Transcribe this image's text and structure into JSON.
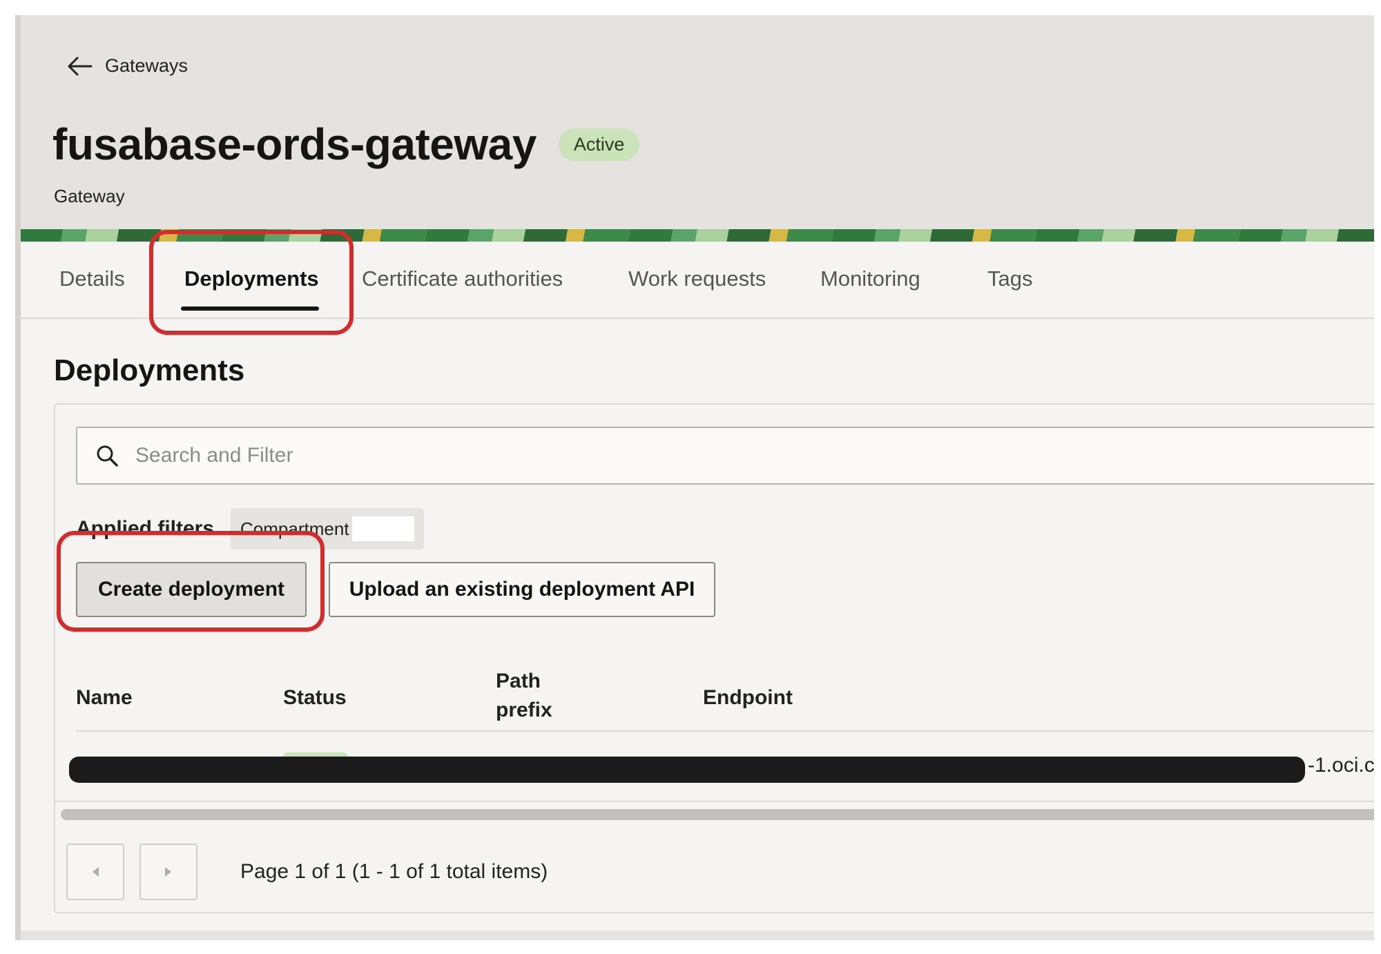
{
  "header": {
    "back_label": "Gateways",
    "title": "fusabase-ords-gateway",
    "status_badge": "Active",
    "subtitle": "Gateway"
  },
  "tabs": [
    {
      "label": "Details"
    },
    {
      "label": "Deployments",
      "active": true
    },
    {
      "label": "Certificate authorities"
    },
    {
      "label": "Work requests"
    },
    {
      "label": "Monitoring"
    },
    {
      "label": "Tags"
    }
  ],
  "section": {
    "title": "Deployments"
  },
  "search": {
    "placeholder": "Search and Filter"
  },
  "filters": {
    "label": "Applied filters",
    "chips": [
      {
        "name": "Compartment"
      }
    ]
  },
  "actions": {
    "create_label": "Create deployment",
    "upload_label": "Upload an existing deployment API"
  },
  "table": {
    "columns": [
      "Name",
      "Status",
      "Path\nprefix",
      "Endpoint"
    ],
    "rows": [
      {
        "endpoint_visible": "-1.oci.c"
      }
    ]
  },
  "pagination": {
    "text": "Page 1 of 1 (1 - 1 of 1 total items)"
  },
  "colors": {
    "annotation": "#d62b2b",
    "badge_bg": "#cbe3b8",
    "header_bg": "#e5e3df"
  }
}
